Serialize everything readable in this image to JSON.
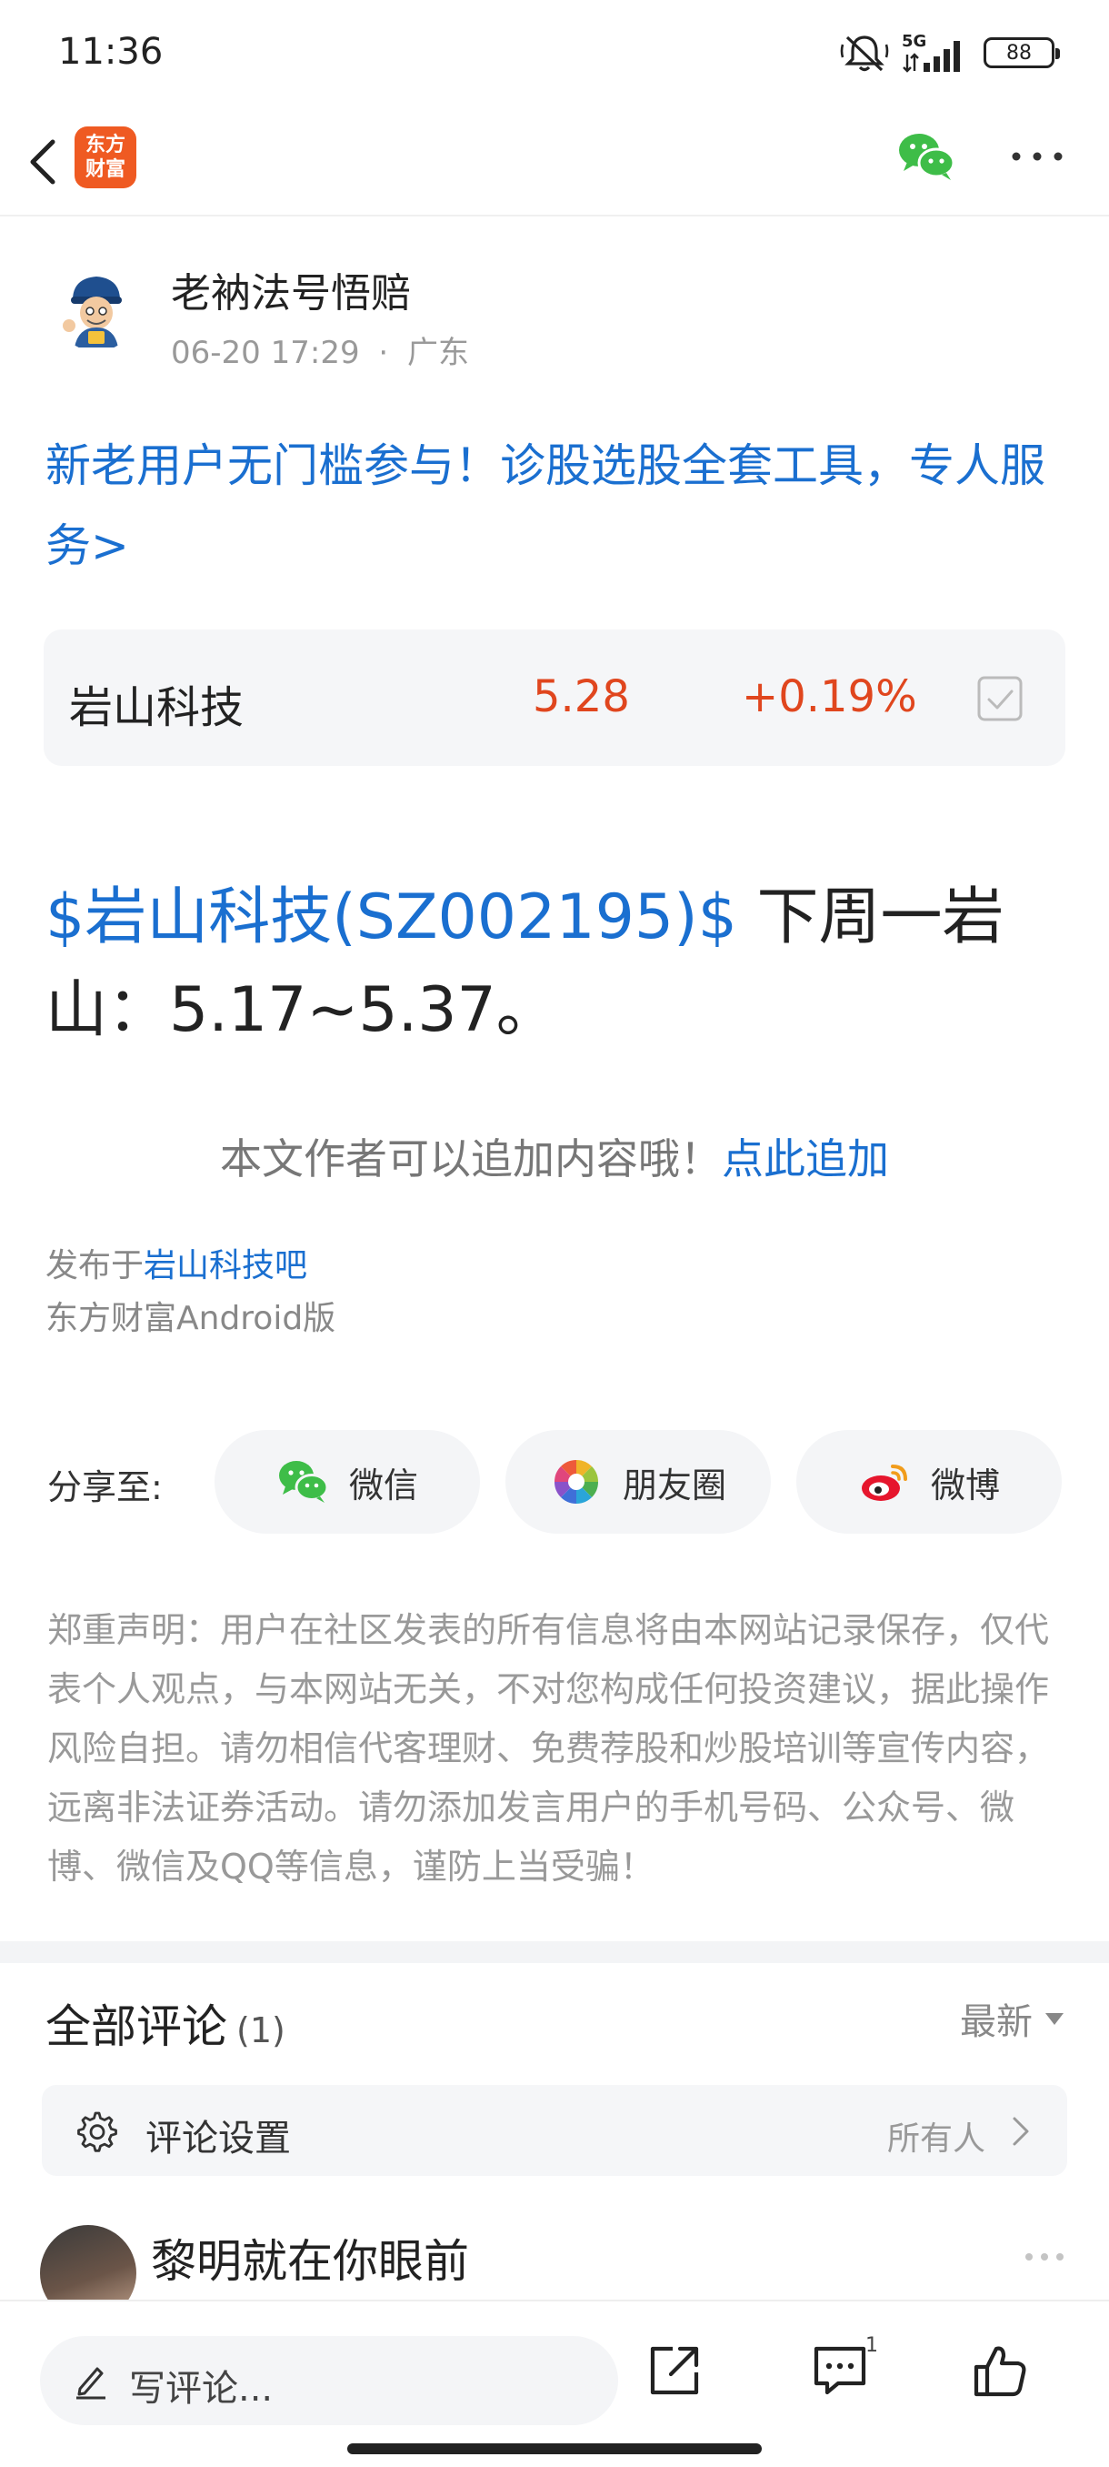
{
  "status_bar": {
    "time": "11:36",
    "network": "5G",
    "battery": "88"
  },
  "header": {
    "app_logo_line1": "东方",
    "app_logo_line2": "财富",
    "share_icon": "wechat-icon",
    "more_icon": "more-dots-icon"
  },
  "author": {
    "name": "老衲法号悟赔",
    "date": "06-20 17:29",
    "separator": "·",
    "location": "广东"
  },
  "promo_text": "新老用户无门槛参与！诊股选股全套工具，专人服务>",
  "stock_card": {
    "name": "岩山科技",
    "price": "5.28",
    "change": "+0.19%"
  },
  "post": {
    "stock_tag": "$岩山科技(SZ002195)$",
    "text": " 下周一岩山：5.17~5.37。"
  },
  "append": {
    "prompt": "本文作者可以追加内容哦！",
    "link": "点此追加"
  },
  "published": {
    "prefix": "发布于",
    "bar": "岩山科技吧",
    "client": "东方财富Android版"
  },
  "share": {
    "label": "分享至:",
    "targets": [
      {
        "label": "微信",
        "icon": "wechat-icon"
      },
      {
        "label": "朋友圈",
        "icon": "moments-icon"
      },
      {
        "label": "微博",
        "icon": "weibo-icon"
      }
    ]
  },
  "disclaimer": "郑重声明：用户在社区发表的所有信息将由本网站记录保存，仅代表个人观点，与本网站无关，不对您构成任何投资建议，据此操作风险自担。请勿相信代客理财、免费荐股和炒股培训等宣传内容，远离非法证券活动。请勿添加发言用户的手机号码、公众号、微博、微信及QQ等信息，谨防上当受骗！",
  "comments": {
    "title": "全部评论",
    "count": "(1)",
    "sort": "最新",
    "settings_label": "评论设置",
    "settings_value": "所有人",
    "first_commenter": "黎明就在你眼前"
  },
  "bottom_bar": {
    "placeholder": "写评论...",
    "comment_count": "1"
  },
  "colors": {
    "link_blue": "#1a6fd0",
    "stock_red": "#e0461e",
    "brand_orange": "#ef5a22"
  }
}
